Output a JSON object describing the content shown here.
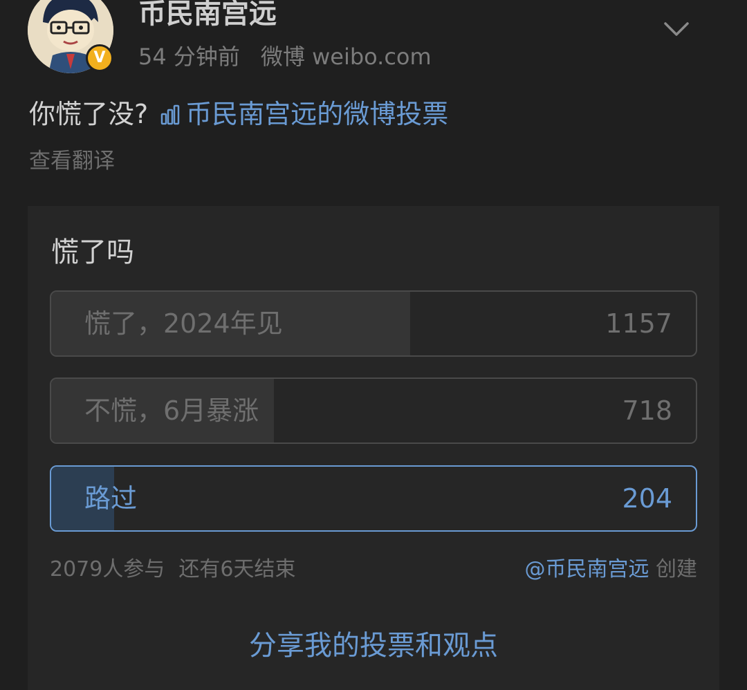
{
  "post": {
    "author": "币民南宫远",
    "time": "54 分钟前",
    "source": "微博 weibo.com",
    "verified_badge": "V",
    "text": "你慌了没?",
    "poll_link_label": "币民南宫远的微博投票",
    "translate_label": "查看翻译"
  },
  "poll": {
    "question": "慌了吗",
    "options": [
      {
        "label": "慌了，2024年见",
        "count": "1157",
        "share": 0.5566,
        "selected": false
      },
      {
        "label": "不慌，6月暴涨",
        "count": "718",
        "share": 0.3454,
        "selected": false
      },
      {
        "label": "路过",
        "count": "204",
        "share": 0.0981,
        "selected": true
      }
    ],
    "participants": "2079人参与",
    "remaining": "还有6天结束",
    "creator_handle": "@币民南宫远",
    "creator_suffix": "创建",
    "share_label": "分享我的投票和观点"
  },
  "icons": {
    "avatar": "cartoon-avatar",
    "verified": "verified-badge-icon",
    "chevron": "chevron-down-icon",
    "poll": "bar-chart-icon"
  },
  "colors": {
    "background": "#1f1f1f",
    "card": "#262626",
    "link": "#6a9bd4",
    "verified": "#f2b01e"
  }
}
